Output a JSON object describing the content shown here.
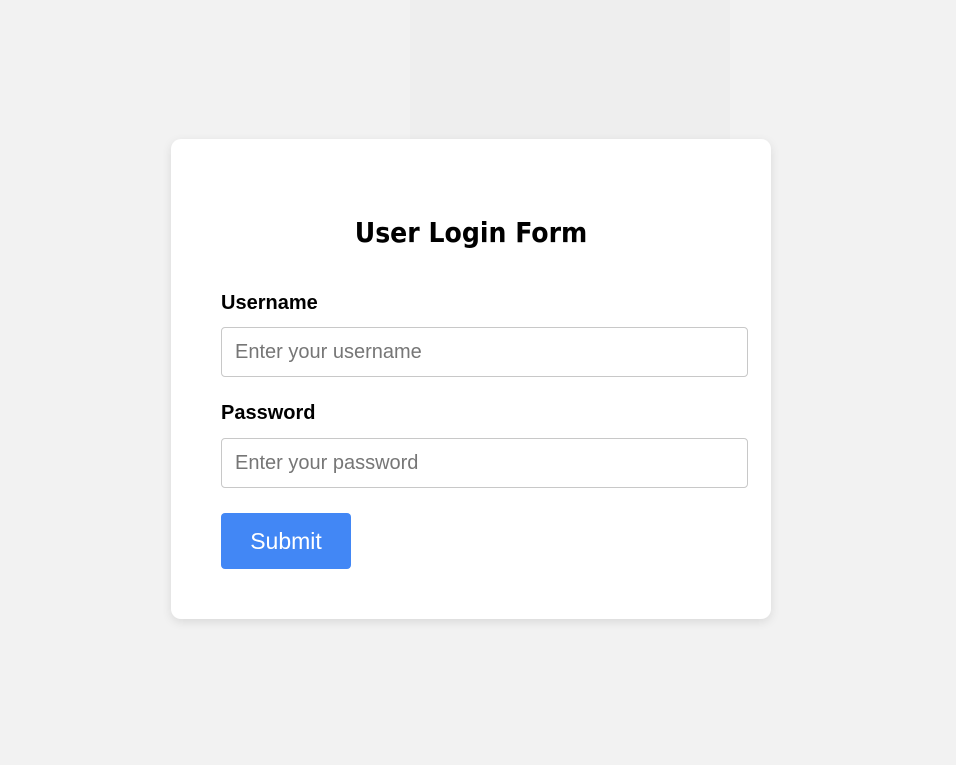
{
  "form": {
    "title": "User Login Form",
    "username": {
      "label": "Username",
      "value": "",
      "placeholder": "Enter your username"
    },
    "password": {
      "label": "Password",
      "value": "",
      "placeholder": "Enter your password"
    },
    "submit_label": "Submit"
  },
  "colors": {
    "page_background": "#f2f2f2",
    "card_background": "#ffffff",
    "accent": "#4287f5",
    "input_border": "#c8c8c8"
  }
}
